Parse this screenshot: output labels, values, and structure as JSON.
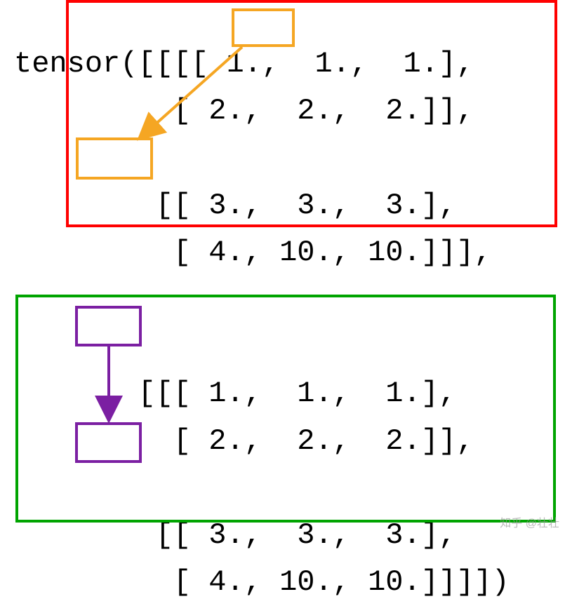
{
  "tensor_prefix": "tensor(",
  "block1": {
    "r1": "[[[[ 1.,  1.,  1.],",
    "r2": "  [ 2.,  2.,  2.]],",
    "r3": "",
    "r4": " [[ 3.,  3.,  3.],",
    "r5": "  [ 4., 10., 10.]]],"
  },
  "block2": {
    "r1": "[[[ 1.,  1.,  1.],",
    "r2": "  [ 2.,  2.,  2.]],",
    "r3": "",
    "r4": " [[ 3.,  3.,  3.],",
    "r5": "  [ 4., 10., 10.]]]])"
  },
  "watermark": "知乎 @壮壮"
}
